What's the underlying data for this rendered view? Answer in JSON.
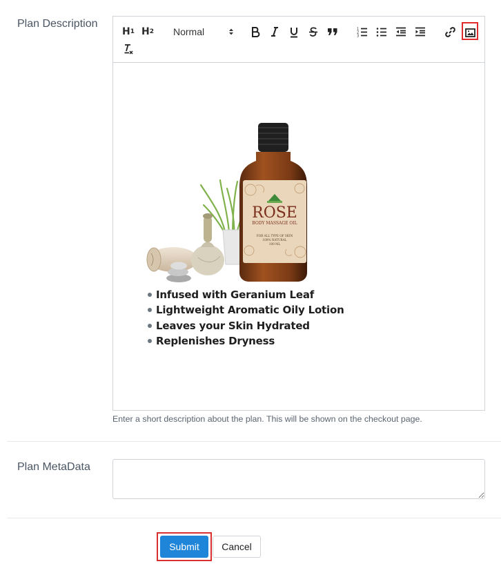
{
  "form": {
    "description_label": "Plan Description",
    "description_help": "Enter a short description about the plan. This will be shown on the checkout page.",
    "metadata_label": "Plan MetaData",
    "metadata_value": "",
    "submit_label": "Submit",
    "cancel_label": "Cancel"
  },
  "toolbar": {
    "h1": "H",
    "h1_sub": "1",
    "h2": "H",
    "h2_sub": "2",
    "format_select": "Normal",
    "icons": [
      "bold-icon",
      "italic-icon",
      "underline-icon",
      "strikethrough-icon",
      "blockquote-icon",
      "ordered-list-icon",
      "bullet-list-icon",
      "outdent-icon",
      "indent-icon",
      "link-icon",
      "image-icon",
      "clear-format-icon"
    ]
  },
  "editor": {
    "product": {
      "brand": "ROSE",
      "subtitle": "BODY MASSAGE OIL",
      "label_line1": "FOR ALL TYPE OF SKIN",
      "label_line2": "100% NATURAL",
      "label_line3": "100 ML"
    },
    "bullets": [
      "Infused with Geranium Leaf",
      "Lightweight Aromatic Oily Lotion",
      "Leaves your Skin Hydrated",
      "Replenishes Dryness"
    ]
  },
  "colors": {
    "submit_bg": "#1f85d8",
    "highlight": "#e12b2b",
    "border": "#cfd3d8"
  }
}
